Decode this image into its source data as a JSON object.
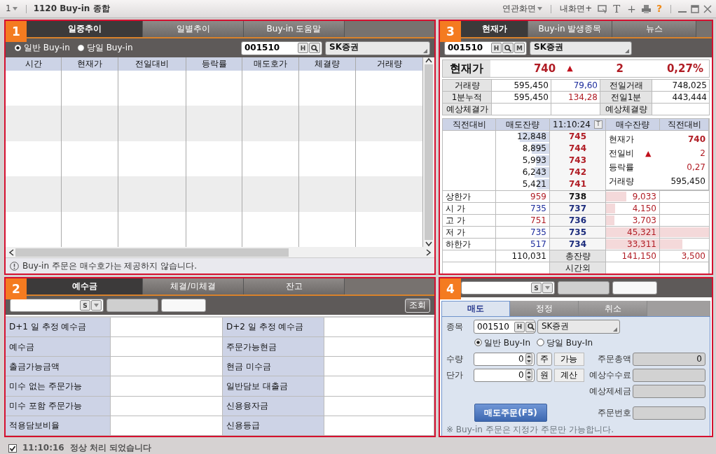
{
  "window": {
    "screen_menu": "1",
    "title": "1120 Buy-in 종합",
    "toolbar": [
      {
        "kind": "menu",
        "label": "연관화면"
      },
      {
        "kind": "text",
        "label": "내화면+"
      },
      {
        "kind": "monitor"
      },
      {
        "kind": "glyph",
        "label": "T"
      },
      {
        "kind": "glyph",
        "label": "+"
      },
      {
        "kind": "printer"
      },
      {
        "kind": "help",
        "label": "?"
      }
    ]
  },
  "trend_panel": {
    "badge": "1",
    "tabs": [
      {
        "label": "일중추이",
        "selected": true
      },
      {
        "label": "일별추이",
        "selected": false
      },
      {
        "label": "Buy-in 도움말",
        "selected": false
      }
    ],
    "radios": [
      {
        "label": "일반 Buy-in",
        "selected": true
      },
      {
        "label": "당일 Buy-in",
        "selected": false
      }
    ],
    "stock": {
      "code": "001510",
      "buttons": [
        {
          "kind": "text",
          "label": "H"
        },
        {
          "kind": "search"
        }
      ],
      "name": "SK증권"
    },
    "columns": [
      "시간",
      "현재가",
      "전일대비",
      "등락률",
      "매도호가",
      "체결량",
      "거래량"
    ],
    "notice": "Buy-in 주문은 매수호가는 제공하지 않습니다."
  },
  "deposit_panel": {
    "badge": "2",
    "tabs": [
      {
        "label": "예수금",
        "selected": true
      },
      {
        "label": "체결/미체결",
        "selected": false
      },
      {
        "label": "잔고",
        "selected": false
      }
    ],
    "account_button": "S",
    "query_button": "조회",
    "rows": [
      {
        "left": "D+1 일 추정 예수금",
        "right": "D+2 일 추정 예수금"
      },
      {
        "left": "예수금",
        "right": "주문가능현금"
      },
      {
        "left": "출금가능금액",
        "right": "현금 미수금"
      },
      {
        "left": "미수 없는 주문가능",
        "right": "일반담보 대출금"
      },
      {
        "left": "미수 포함 주문가능",
        "right": "신용융자금"
      },
      {
        "left": "적용담보비율",
        "right": "신용등급"
      }
    ]
  },
  "quote_panel": {
    "badge": "3",
    "tabs": [
      {
        "label": "현재가",
        "selected": true
      },
      {
        "label": "Buy-in 발생종목",
        "selected": false
      },
      {
        "label": "뉴스",
        "selected": false
      }
    ],
    "stock": {
      "code": "001510",
      "buttons": [
        {
          "kind": "text",
          "label": "H"
        },
        {
          "kind": "search"
        },
        {
          "kind": "text",
          "label": "M"
        }
      ],
      "name": "SK증권"
    },
    "price": {
      "label": "현재가",
      "value": "740",
      "arrow": "▲",
      "change": "2",
      "rate": "0,27%"
    },
    "info": [
      {
        "label": "거래량",
        "value": "595,450",
        "ratio": {
          "text": "79,60",
          "color": "#1c2c9c"
        },
        "label2": "전일거래",
        "value2": "748,025"
      },
      {
        "label": "1분누적",
        "value": "595,450",
        "ratio": {
          "text": "134,28",
          "color": "#b01c24"
        },
        "label2": "전일1분",
        "value2": "443,444"
      },
      {
        "label": "예상체결가",
        "label2": "예상체결량"
      }
    ],
    "book": {
      "columns": [
        "직전대비",
        "매도잔량",
        "11:10:24",
        "매수잔량",
        "직전대비"
      ],
      "header_button": "T",
      "asks": [
        {
          "qty": "12,848",
          "level": 0.55,
          "price": "745",
          "color": "#b01c24"
        },
        {
          "qty": "8,895",
          "level": 0.33,
          "price": "744",
          "color": "#b01c24"
        },
        {
          "qty": "5,993",
          "level": 0.25,
          "price": "743",
          "color": "#b01c24"
        },
        {
          "qty": "6,243",
          "level": 0.27,
          "price": "742",
          "color": "#b01c24"
        },
        {
          "qty": "5,421",
          "level": 0.22,
          "price": "741",
          "color": "#b01c24"
        }
      ],
      "summary": [
        {
          "label": "현재가",
          "value": "740",
          "color": "#b01c24",
          "bold": true
        },
        {
          "label": "전일비",
          "arrow": "▲",
          "value": "2",
          "color": "#b01c24"
        },
        {
          "label": "등락률",
          "value": "0,27",
          "color": "#b01c24"
        },
        {
          "label": "거래량",
          "value": "595,450",
          "color": "#111111"
        }
      ],
      "bids": [
        {
          "label": "상한가",
          "value": {
            "text": "959",
            "color": "#b01c24"
          },
          "price": {
            "text": "738",
            "color": "#111111"
          },
          "qty": "9,033",
          "level": 0.2
        },
        {
          "label": "시 가",
          "value": {
            "text": "735",
            "color": "#1c2c9c"
          },
          "price": {
            "text": "737",
            "color": "#1c2c7c"
          },
          "qty": "4,150",
          "level": 0.09
        },
        {
          "label": "고 가",
          "value": {
            "text": "751",
            "color": "#b01c24"
          },
          "price": {
            "text": "736",
            "color": "#1c2c7c"
          },
          "qty": "3,703",
          "level": 0.08
        },
        {
          "label": "저 가",
          "value": {
            "text": "735",
            "color": "#1c2c9c"
          },
          "price": {
            "text": "735",
            "color": "#1c2c7c"
          },
          "qty": "45,321",
          "level": 1
        },
        {
          "label": "하한가",
          "value": {
            "text": "517",
            "color": "#1c2c9c"
          },
          "price": {
            "text": "734",
            "color": "#1c2c7c"
          },
          "qty": "33,311",
          "level": 0.74
        }
      ],
      "totals": {
        "ask_total": "110,031",
        "label": "총잔량",
        "bid_total": "141,150",
        "change": "3,500"
      },
      "after_hours": "시간외"
    }
  },
  "order_panel": {
    "badge": "4",
    "account_button": "S",
    "tabs": [
      {
        "label": "매도",
        "selected": true
      },
      {
        "label": "정정",
        "selected": false
      },
      {
        "label": "취소",
        "selected": false
      }
    ],
    "stock_label": "종목",
    "stock": {
      "code": "001510",
      "buttons": [
        {
          "kind": "text",
          "label": "H"
        },
        {
          "kind": "search"
        }
      ],
      "name": "SK증권"
    },
    "radios": [
      {
        "label": "일반 Buy-In",
        "selected": true
      },
      {
        "label": "당일 Buy-In",
        "selected": false
      }
    ],
    "inputs": [
      {
        "label": "수량",
        "value": "0",
        "unit": "주",
        "action": "가능",
        "total_label": "주문총액",
        "total_value": "0"
      },
      {
        "label": "단가",
        "value": "0",
        "unit": "원",
        "action": "계산",
        "total_label": "예상수수료"
      }
    ],
    "tax_label": "예상제세금",
    "submit": "매도주문(F5)",
    "order_no_label": "주문번호",
    "note": "※ Buy-in 주문은 지정가 주문만 가능합니다."
  },
  "status_bar": {
    "checked": true,
    "time": "11:10:16",
    "message": "정상 처리 되었습니다"
  }
}
